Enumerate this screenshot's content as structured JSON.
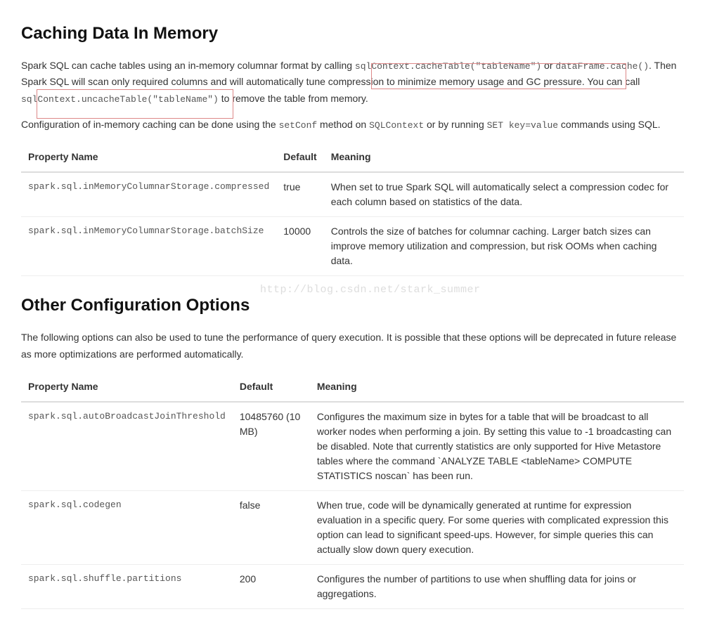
{
  "section1": {
    "heading": "Caching Data In Memory",
    "p1_a": "Spark SQL can cache tables using an in-memory columnar format by calling ",
    "p1_code1": "sqlContext.cacheTable(\"tableName\")",
    "p1_b": " or ",
    "p1_code2": "dataFrame.cache()",
    "p1_c": ". Then Spark SQL will scan only required columns and will automatically tune compression to minimize memory usage and GC pressure. You can call ",
    "p1_code3": "sqlContext.uncacheTable(\"tableName\")",
    "p1_d": " to remove the table from memory.",
    "p2_a": "Configuration of in-memory caching can be done using the ",
    "p2_code1": "setConf",
    "p2_b": " method on ",
    "p2_code2": "SQLContext",
    "p2_c": " or by running ",
    "p2_code3": "SET key=value",
    "p2_d": " commands using SQL."
  },
  "table1": {
    "h1": "Property Name",
    "h2": "Default",
    "h3": "Meaning",
    "rows": [
      {
        "name": "spark.sql.inMemoryColumnarStorage.compressed",
        "default": "true",
        "meaning": "When set to true Spark SQL will automatically select a compression codec for each column based on statistics of the data."
      },
      {
        "name": "spark.sql.inMemoryColumnarStorage.batchSize",
        "default": "10000",
        "meaning": "Controls the size of batches for columnar caching. Larger batch sizes can improve memory utilization and compression, but risk OOMs when caching data."
      }
    ]
  },
  "section2": {
    "heading": "Other Configuration Options",
    "p1": "The following options can also be used to tune the performance of query execution. It is possible that these options will be deprecated in future release as more optimizations are performed automatically."
  },
  "table2": {
    "h1": "Property Name",
    "h2": "Default",
    "h3": "Meaning",
    "rows": [
      {
        "name": "spark.sql.autoBroadcastJoinThreshold",
        "default": "10485760 (10 MB)",
        "meaning": "Configures the maximum size in bytes for a table that will be broadcast to all worker nodes when performing a join. By setting this value to -1 broadcasting can be disabled. Note that currently statistics are only supported for Hive Metastore tables where the command `ANALYZE TABLE <tableName> COMPUTE STATISTICS noscan` has been run."
      },
      {
        "name": "spark.sql.codegen",
        "default": "false",
        "meaning": "When true, code will be dynamically generated at runtime for expression evaluation in a specific query. For some queries with complicated expression this option can lead to significant speed-ups. However, for simple queries this can actually slow down query execution."
      },
      {
        "name": "spark.sql.shuffle.partitions",
        "default": "200",
        "meaning": "Configures the number of partitions to use when shuffling data for joins or aggregations."
      }
    ]
  },
  "watermark": "http://blog.csdn.net/stark_summer"
}
